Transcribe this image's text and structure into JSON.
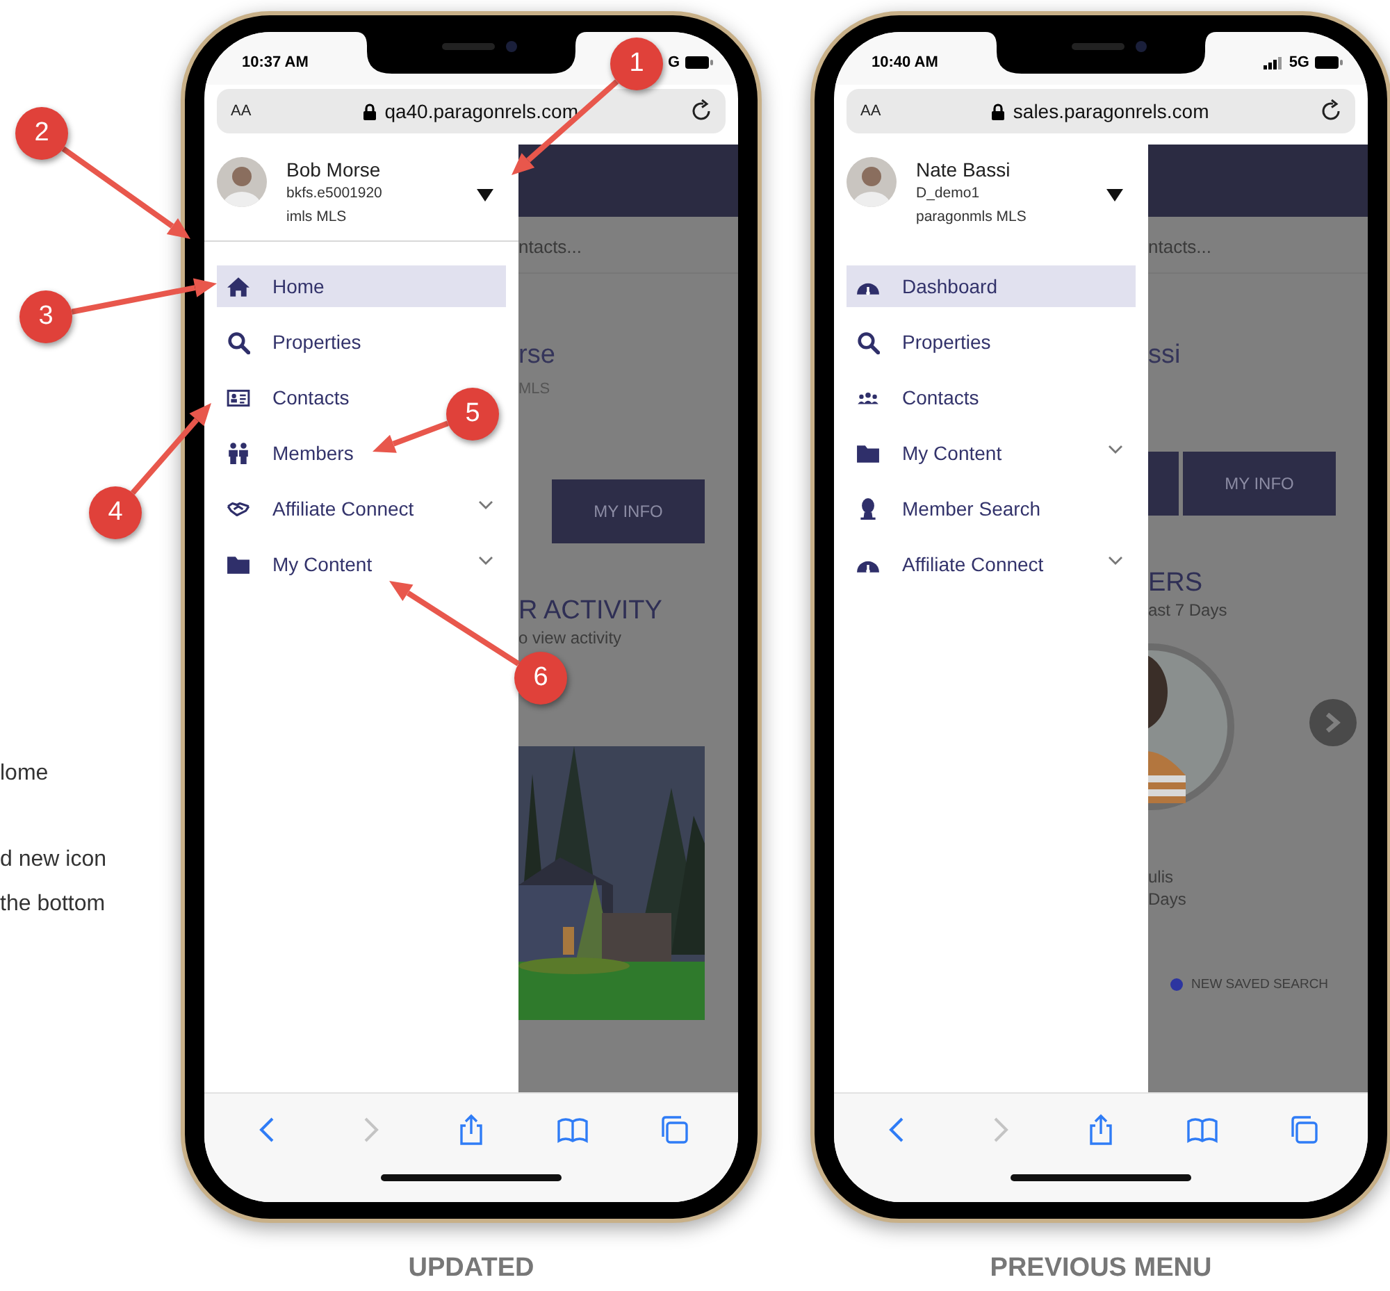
{
  "notes": [
    "lome",
    "d new icon",
    "the bottom"
  ],
  "phones": [
    {
      "time": "10:37 AM",
      "signal": false,
      "network": "G",
      "text_size": "AA",
      "url": "qa40.paragonrels.com",
      "user": {
        "name": "Bob Morse",
        "id": "bkfs.e5001920",
        "mls": "imls MLS"
      },
      "divider": true,
      "menu": [
        {
          "kind": "home",
          "label": "Home",
          "selected": true,
          "expandable": false
        },
        {
          "kind": "search",
          "label": "Properties",
          "selected": false,
          "expandable": false
        },
        {
          "kind": "card",
          "label": "Contacts",
          "selected": false,
          "expandable": false
        },
        {
          "kind": "members",
          "label": "Members",
          "selected": false,
          "expandable": false
        },
        {
          "kind": "handshake",
          "label": "Affiliate Connect",
          "selected": false,
          "expandable": true
        },
        {
          "kind": "folder",
          "label": "My Content",
          "selected": false,
          "expandable": true
        }
      ],
      "backdrop": [
        {
          "kind": "header"
        },
        {
          "kind": "hint",
          "text": "ntacts..."
        },
        {
          "kind": "name",
          "text": "rse"
        },
        {
          "kind": "small",
          "text": "MLS"
        },
        {
          "kind": "button",
          "text": "MY INFO",
          "stub": false
        },
        {
          "kind": "heading",
          "text": "R ACTIVITY"
        },
        {
          "kind": "caption",
          "text": "o view activity"
        },
        {
          "kind": "picture"
        }
      ],
      "toolbar": [
        {
          "kind": "back",
          "disabled": false
        },
        {
          "kind": "forward",
          "disabled": true
        },
        {
          "kind": "share",
          "disabled": false
        },
        {
          "kind": "book",
          "disabled": false
        },
        {
          "kind": "tabs",
          "disabled": false
        }
      ],
      "caption": "UPDATED"
    },
    {
      "time": "10:40 AM",
      "signal": true,
      "network": "5G",
      "text_size": "AA",
      "url": "sales.paragonrels.com",
      "user": {
        "name": "Nate Bassi",
        "id": "D_demo1",
        "mls": "paragonmls MLS"
      },
      "divider": false,
      "menu": [
        {
          "kind": "gauge",
          "label": "Dashboard",
          "selected": true,
          "expandable": false
        },
        {
          "kind": "search",
          "label": "Properties",
          "selected": false,
          "expandable": false
        },
        {
          "kind": "people",
          "label": "Contacts",
          "selected": false,
          "expandable": false
        },
        {
          "kind": "folder",
          "label": "My Content",
          "selected": false,
          "expandable": true
        },
        {
          "kind": "person",
          "label": "Member Search",
          "selected": false,
          "expandable": false
        },
        {
          "kind": "gauge",
          "label": "Affiliate Connect",
          "selected": false,
          "expandable": true
        }
      ],
      "backdrop": [
        {
          "kind": "header"
        },
        {
          "kind": "hint",
          "text": "ntacts..."
        },
        {
          "kind": "name",
          "text": "ssi"
        },
        {
          "kind": "button",
          "text": "MY INFO",
          "stub": true
        },
        {
          "kind": "heading",
          "text": "ERS"
        },
        {
          "kind": "caption",
          "text": "ast 7 Days"
        },
        {
          "kind": "carousel"
        },
        {
          "kind": "name2",
          "text": "ulis"
        },
        {
          "kind": "caption",
          "text": "Days"
        },
        {
          "kind": "legend",
          "text": "NEW SAVED SEARCH"
        }
      ],
      "toolbar": [
        {
          "kind": "back",
          "disabled": false
        },
        {
          "kind": "forward",
          "disabled": true
        },
        {
          "kind": "share",
          "disabled": false
        },
        {
          "kind": "book",
          "disabled": false
        },
        {
          "kind": "tabs",
          "disabled": false
        }
      ],
      "caption": "PREVIOUS MENU"
    }
  ],
  "annotations": [
    {
      "number": "1"
    },
    {
      "number": "2"
    },
    {
      "number": "3"
    },
    {
      "number": "4"
    },
    {
      "number": "5"
    },
    {
      "number": "6"
    }
  ]
}
